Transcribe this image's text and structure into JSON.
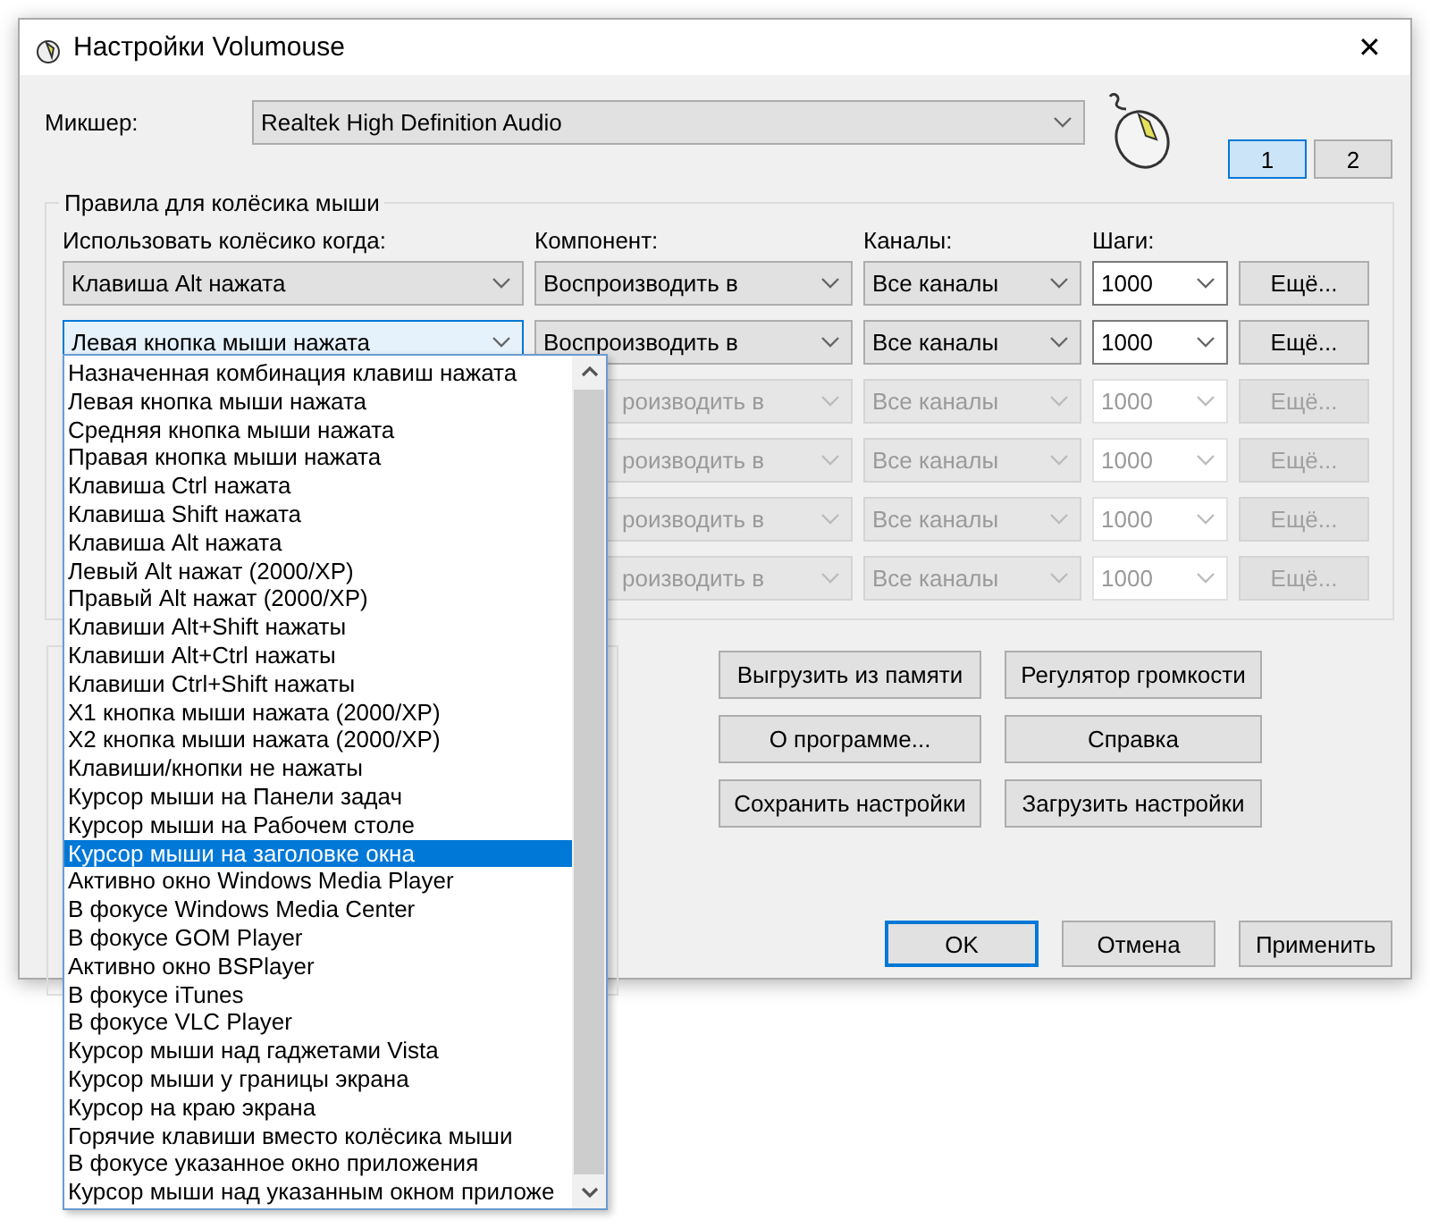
{
  "window": {
    "title": "Настройки Volumouse",
    "close": "✕"
  },
  "mixer": {
    "label": "Микшер:",
    "value": "Realtek High Definition Audio"
  },
  "tabs": [
    {
      "label": "1",
      "selected": true
    },
    {
      "label": "2",
      "selected": false
    }
  ],
  "rules": {
    "title": "Правила для колёсика мыши",
    "columns": [
      "Использовать колёсико когда:",
      "Компонент:",
      "Каналы:",
      "Шаги:"
    ],
    "rows": [
      {
        "condition": "Клавиша Alt нажата",
        "component": "Воспроизводить в",
        "channels": "Все каналы",
        "steps": "1000",
        "more": "Ещё...",
        "disabled": false,
        "open": false
      },
      {
        "condition": "Левая кнопка мыши нажата",
        "component": "Воспроизводить в",
        "channels": "Все каналы",
        "steps": "1000",
        "more": "Ещё...",
        "disabled": false,
        "open": true
      },
      {
        "component": "роизводить в",
        "channels": "Все каналы",
        "steps": "1000",
        "more": "Ещё...",
        "disabled": true
      },
      {
        "component": "роизводить в",
        "channels": "Все каналы",
        "steps": "1000",
        "more": "Ещё...",
        "disabled": true
      },
      {
        "component": "роизводить в",
        "channels": "Все каналы",
        "steps": "1000",
        "more": "Ещё...",
        "disabled": true
      },
      {
        "component": "роизводить в",
        "channels": "Все каналы",
        "steps": "1000",
        "more": "Ещё...",
        "disabled": true
      }
    ]
  },
  "actions": [
    "Выгрузить из памяти",
    "Регулятор громкости",
    "О программе...",
    "Справка",
    "Сохранить настройки",
    "Загрузить настройки"
  ],
  "dialog_buttons": [
    {
      "label": "OK",
      "default": true
    },
    {
      "label": "Отмена",
      "default": false
    },
    {
      "label": "Применить",
      "default": false
    }
  ],
  "dropdown": {
    "items": [
      {
        "label": "Назначенная комбинация клавиш нажата",
        "selected": false
      },
      {
        "label": "Левая кнопка мыши нажата",
        "selected": false
      },
      {
        "label": "Средняя кнопка мыши нажата",
        "selected": false
      },
      {
        "label": "Правая кнопка мыши нажата",
        "selected": false
      },
      {
        "label": "Клавиша Ctrl нажата",
        "selected": false
      },
      {
        "label": "Клавиша Shift нажата",
        "selected": false
      },
      {
        "label": "Клавиша Alt нажата",
        "selected": false
      },
      {
        "label": "Левый Alt нажат (2000/XP)",
        "selected": false
      },
      {
        "label": "Правый Alt нажат (2000/XP)",
        "selected": false
      },
      {
        "label": "Клавиши Alt+Shift нажаты",
        "selected": false
      },
      {
        "label": "Клавиши Alt+Ctrl нажаты",
        "selected": false
      },
      {
        "label": "Клавиши Ctrl+Shift нажаты",
        "selected": false
      },
      {
        "label": "X1 кнопка мыши нажата (2000/XP)",
        "selected": false
      },
      {
        "label": "X2 кнопка мыши нажата (2000/XP)",
        "selected": false
      },
      {
        "label": "Клавиши/кнопки не нажаты",
        "selected": false
      },
      {
        "label": "Курсор мыши на Панели задач",
        "selected": false
      },
      {
        "label": "Курсор мыши на Рабочем столе",
        "selected": false
      },
      {
        "label": "Курсор мыши на заголовке окна",
        "selected": true
      },
      {
        "label": "Активно окно Windows Media Player",
        "selected": false
      },
      {
        "label": "В фокусе Windows Media Center",
        "selected": false
      },
      {
        "label": "В фокусе GOM Player",
        "selected": false
      },
      {
        "label": "Активно окно BSPlayer",
        "selected": false
      },
      {
        "label": "В фокусе iTunes",
        "selected": false
      },
      {
        "label": "В фокусе VLC Player",
        "selected": false
      },
      {
        "label": "Курсор мыши над гаджетами Vista",
        "selected": false
      },
      {
        "label": "Курсор мыши у границы экрана",
        "selected": false
      },
      {
        "label": "Курсор на краю экрана",
        "selected": false
      },
      {
        "label": "Горячие клавиши вместо колёсика мыши",
        "selected": false
      },
      {
        "label": "В фокусе указанное окно приложения",
        "selected": false
      },
      {
        "label": "Курсор мыши над указанным окном приложе",
        "selected": false
      }
    ]
  }
}
